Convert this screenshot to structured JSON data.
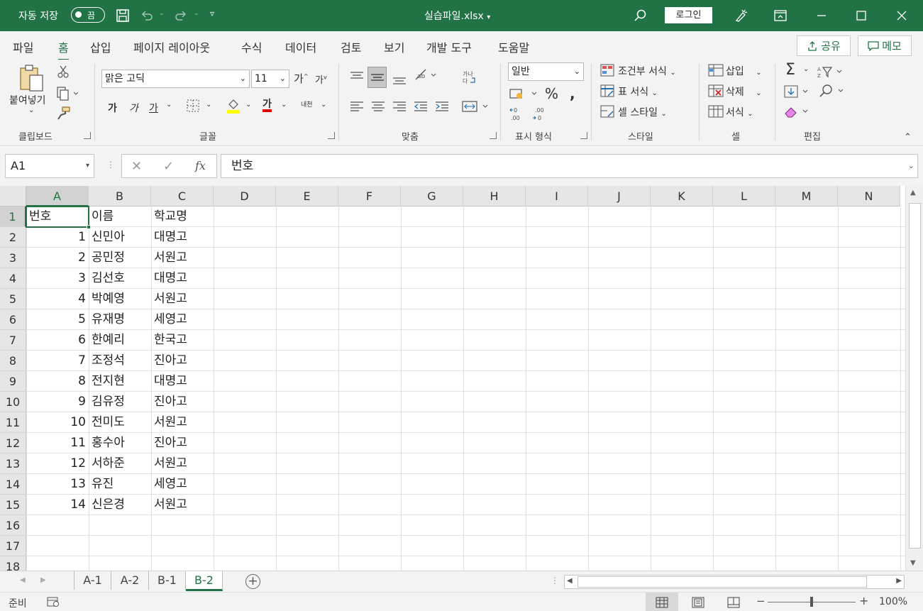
{
  "titlebar": {
    "autosave_label": "자동 저장",
    "autosave_toggle": "끔",
    "file_name": "실습파일.xlsx",
    "login_label": "로그인"
  },
  "ribbon_tabs": [
    "파일",
    "홈",
    "삽입",
    "페이지 레이아웃",
    "수식",
    "데이터",
    "검토",
    "보기",
    "개발 도구",
    "도움말"
  ],
  "active_tab": "홈",
  "share_label": "공유",
  "memo_label": "메모",
  "ribbon": {
    "paste_label": "붙여넣기",
    "font_name": "맑은 고딕",
    "font_size": "11",
    "bold": "가",
    "italic": "가",
    "underline": "가",
    "font_color_glyph": "가",
    "phonetic": "내천",
    "number_format": "일반",
    "conditional_format": "조건부 서식",
    "table_format": "표 서식",
    "cell_style": "셀 스타일",
    "insert": "삽입",
    "delete": "삭제",
    "format": "서식",
    "groups": {
      "clipboard": "클립보드",
      "font": "글꼴",
      "alignment": "맞춤",
      "number": "표시 형식",
      "styles": "스타일",
      "cells": "셀",
      "editing": "편집"
    }
  },
  "formula_bar": {
    "name_box": "A1",
    "content": "번호"
  },
  "columns": [
    "A",
    "B",
    "C",
    "D",
    "E",
    "F",
    "G",
    "H",
    "I",
    "J",
    "K",
    "L",
    "M",
    "N"
  ],
  "row_numbers": [
    "1",
    "2",
    "3",
    "4",
    "5",
    "6",
    "7",
    "8",
    "9",
    "10",
    "11",
    "12",
    "13",
    "14",
    "15",
    "16",
    "17",
    "18"
  ],
  "sheet_data": [
    {
      "a": "번호",
      "b": "이름",
      "c": "학교명"
    },
    {
      "a": "1",
      "b": "신민아",
      "c": "대명고"
    },
    {
      "a": "2",
      "b": "공민정",
      "c": "서원고"
    },
    {
      "a": "3",
      "b": "김선호",
      "c": "대명고"
    },
    {
      "a": "4",
      "b": "박예영",
      "c": "서원고"
    },
    {
      "a": "5",
      "b": "유재명",
      "c": "세영고"
    },
    {
      "a": "6",
      "b": "한예리",
      "c": "한국고"
    },
    {
      "a": "7",
      "b": "조정석",
      "c": "진아고"
    },
    {
      "a": "8",
      "b": "전지현",
      "c": "대명고"
    },
    {
      "a": "9",
      "b": "김유정",
      "c": "진아고"
    },
    {
      "a": "10",
      "b": "전미도",
      "c": "서원고"
    },
    {
      "a": "11",
      "b": "홍수아",
      "c": "진아고"
    },
    {
      "a": "12",
      "b": "서하준",
      "c": "서원고"
    },
    {
      "a": "13",
      "b": "유진",
      "c": "세영고"
    },
    {
      "a": "14",
      "b": "신은경",
      "c": "서원고"
    }
  ],
  "sheets": [
    "A-1",
    "A-2",
    "B-1",
    "B-2"
  ],
  "active_sheet": "B-2",
  "status": {
    "mode": "준비",
    "zoom": "100%"
  },
  "colors": {
    "accent": "#217346"
  }
}
